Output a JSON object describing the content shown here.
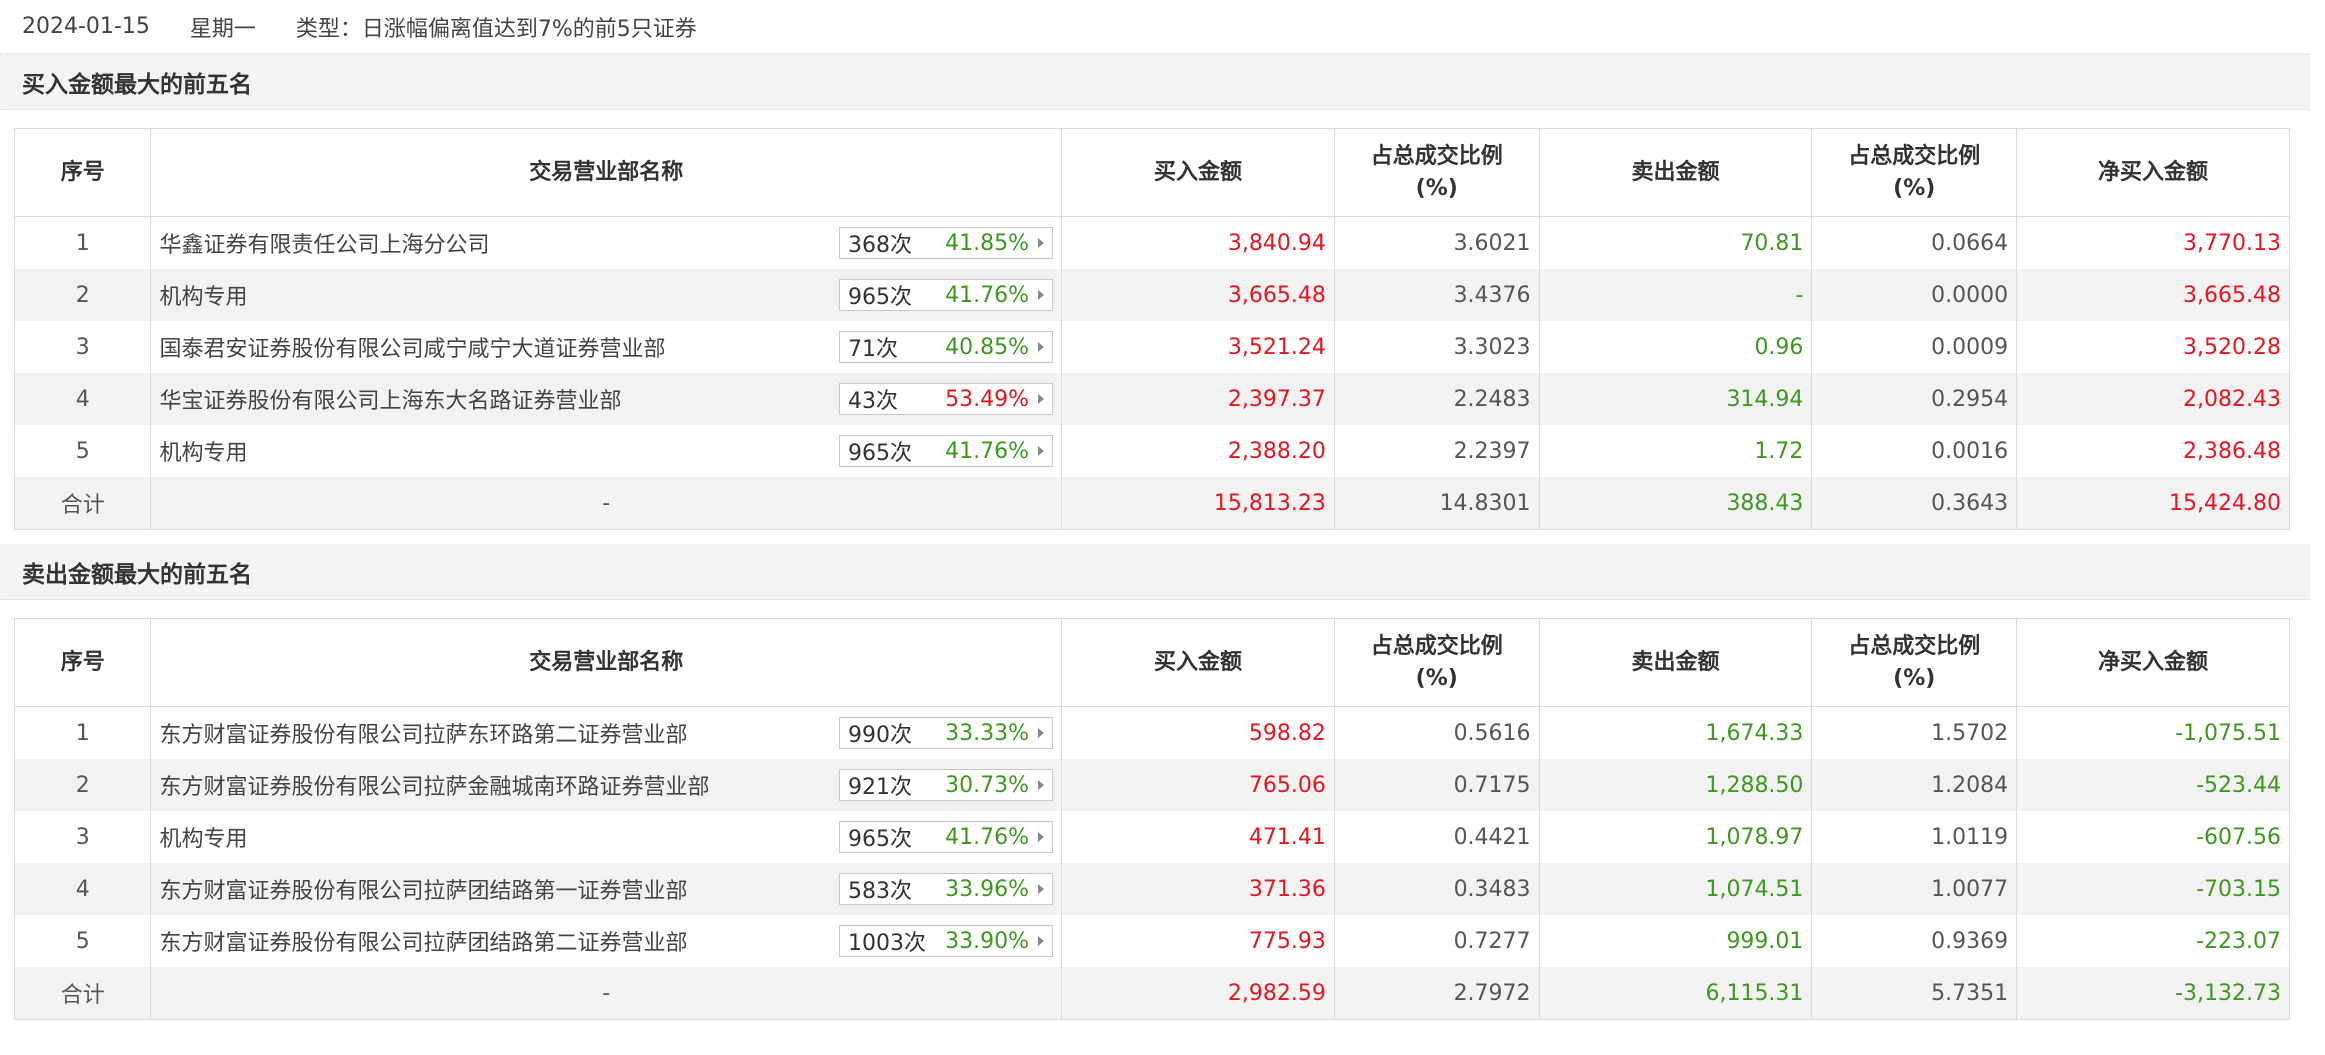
{
  "header": {
    "date": "2024-01-15",
    "weekday": "星期一",
    "type_label": "类型：日涨幅偏离值达到7%的前5只证券"
  },
  "colors": {
    "up": "#e8141e",
    "down": "#3b9a1d"
  },
  "columns": {
    "seq": "序号",
    "dept": "交易营业部名称",
    "buy": "买入金额",
    "ratio1_line1": "占总成交比例",
    "ratio1_line2": "(%)",
    "sell": "卖出金额",
    "ratio2_line1": "占总成交比例",
    "ratio2_line2": "(%)",
    "net": "净买入金额"
  },
  "buy_top": {
    "title": "买入金额最大的前五名",
    "rows": [
      {
        "seq": "1",
        "name": "华鑫证券有限责任公司上海分公司",
        "count": "368次",
        "pct": "41.85%",
        "pct_color": "green",
        "buy": "3,840.94",
        "r1": "3.6021",
        "sell": "70.81",
        "r2": "0.0664",
        "net": "3,770.13",
        "net_color": "red"
      },
      {
        "seq": "2",
        "name": "机构专用",
        "count": "965次",
        "pct": "41.76%",
        "pct_color": "green",
        "buy": "3,665.48",
        "r1": "3.4376",
        "sell": "-",
        "r2": "0.0000",
        "net": "3,665.48",
        "net_color": "red"
      },
      {
        "seq": "3",
        "name": "国泰君安证券股份有限公司咸宁咸宁大道证券营业部",
        "count": "71次",
        "pct": "40.85%",
        "pct_color": "green",
        "buy": "3,521.24",
        "r1": "3.3023",
        "sell": "0.96",
        "r2": "0.0009",
        "net": "3,520.28",
        "net_color": "red"
      },
      {
        "seq": "4",
        "name": "华宝证券股份有限公司上海东大名路证券营业部",
        "count": "43次",
        "pct": "53.49%",
        "pct_color": "red",
        "buy": "2,397.37",
        "r1": "2.2483",
        "sell": "314.94",
        "r2": "0.2954",
        "net": "2,082.43",
        "net_color": "red"
      },
      {
        "seq": "5",
        "name": "机构专用",
        "count": "965次",
        "pct": "41.76%",
        "pct_color": "green",
        "buy": "2,388.20",
        "r1": "2.2397",
        "sell": "1.72",
        "r2": "0.0016",
        "net": "2,386.48",
        "net_color": "red"
      }
    ],
    "total": {
      "label": "合计",
      "name": "-",
      "buy": "15,813.23",
      "r1": "14.8301",
      "sell": "388.43",
      "r2": "0.3643",
      "net": "15,424.80",
      "net_color": "red"
    }
  },
  "sell_top": {
    "title": "卖出金额最大的前五名",
    "rows": [
      {
        "seq": "1",
        "name": "东方财富证券股份有限公司拉萨东环路第二证券营业部",
        "count": "990次",
        "pct": "33.33%",
        "pct_color": "green",
        "buy": "598.82",
        "r1": "0.5616",
        "sell": "1,674.33",
        "r2": "1.5702",
        "net": "-1,075.51",
        "net_color": "green"
      },
      {
        "seq": "2",
        "name": "东方财富证券股份有限公司拉萨金融城南环路证券营业部",
        "count": "921次",
        "pct": "30.73%",
        "pct_color": "green",
        "buy": "765.06",
        "r1": "0.7175",
        "sell": "1,288.50",
        "r2": "1.2084",
        "net": "-523.44",
        "net_color": "green"
      },
      {
        "seq": "3",
        "name": "机构专用",
        "count": "965次",
        "pct": "41.76%",
        "pct_color": "green",
        "buy": "471.41",
        "r1": "0.4421",
        "sell": "1,078.97",
        "r2": "1.0119",
        "net": "-607.56",
        "net_color": "green"
      },
      {
        "seq": "4",
        "name": "东方财富证券股份有限公司拉萨团结路第一证券营业部",
        "count": "583次",
        "pct": "33.96%",
        "pct_color": "green",
        "buy": "371.36",
        "r1": "0.3483",
        "sell": "1,074.51",
        "r2": "1.0077",
        "net": "-703.15",
        "net_color": "green"
      },
      {
        "seq": "5",
        "name": "东方财富证券股份有限公司拉萨团结路第二证券营业部",
        "count": "1003次",
        "pct": "33.90%",
        "pct_color": "green",
        "buy": "775.93",
        "r1": "0.7277",
        "sell": "999.01",
        "r2": "0.9369",
        "net": "-223.07",
        "net_color": "green"
      }
    ],
    "total": {
      "label": "合计",
      "name": "-",
      "buy": "2,982.59",
      "r1": "2.7972",
      "sell": "6,115.31",
      "r2": "5.7351",
      "net": "-3,132.73",
      "net_color": "green"
    }
  }
}
